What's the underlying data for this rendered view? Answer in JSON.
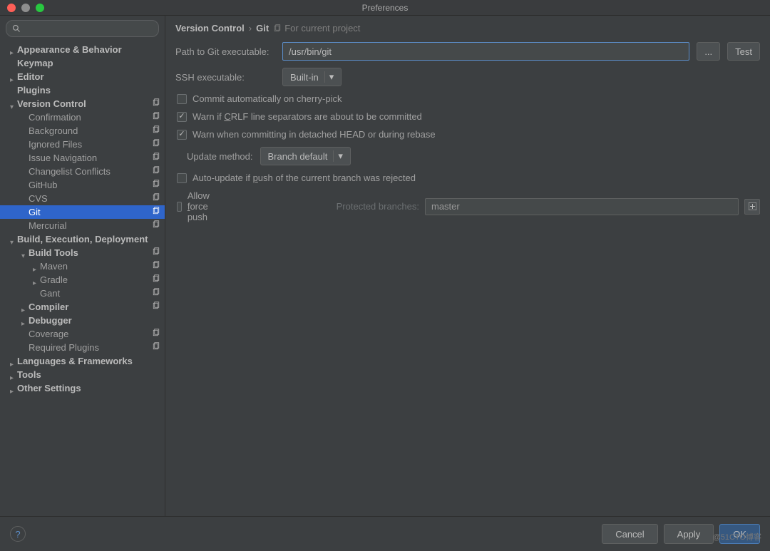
{
  "window": {
    "title": "Preferences"
  },
  "search": {
    "placeholder": ""
  },
  "tree": [
    {
      "label": "Appearance & Behavior",
      "level": 0,
      "arrow": "col",
      "bold": true
    },
    {
      "label": "Keymap",
      "level": 0,
      "arrow": "none",
      "bold": true
    },
    {
      "label": "Editor",
      "level": 0,
      "arrow": "col",
      "bold": true
    },
    {
      "label": "Plugins",
      "level": 0,
      "arrow": "none",
      "bold": true
    },
    {
      "label": "Version Control",
      "level": 0,
      "arrow": "exp",
      "bold": true,
      "badge": true
    },
    {
      "label": "Confirmation",
      "level": 1,
      "arrow": "none",
      "badge": true
    },
    {
      "label": "Background",
      "level": 1,
      "arrow": "none",
      "badge": true
    },
    {
      "label": "Ignored Files",
      "level": 1,
      "arrow": "none",
      "badge": true
    },
    {
      "label": "Issue Navigation",
      "level": 1,
      "arrow": "none",
      "badge": true
    },
    {
      "label": "Changelist Conflicts",
      "level": 1,
      "arrow": "none",
      "badge": true
    },
    {
      "label": "GitHub",
      "level": 1,
      "arrow": "none",
      "badge": true
    },
    {
      "label": "CVS",
      "level": 1,
      "arrow": "none",
      "badge": true
    },
    {
      "label": "Git",
      "level": 1,
      "arrow": "none",
      "badge": true,
      "selected": true
    },
    {
      "label": "Mercurial",
      "level": 1,
      "arrow": "none",
      "badge": true
    },
    {
      "label": "Build, Execution, Deployment",
      "level": 0,
      "arrow": "exp",
      "bold": true
    },
    {
      "label": "Build Tools",
      "level": 1,
      "arrow": "exp",
      "bold": true,
      "badge": true
    },
    {
      "label": "Maven",
      "level": 2,
      "arrow": "col",
      "badge": true
    },
    {
      "label": "Gradle",
      "level": 2,
      "arrow": "col",
      "badge": true
    },
    {
      "label": "Gant",
      "level": 2,
      "arrow": "none",
      "badge": true
    },
    {
      "label": "Compiler",
      "level": 1,
      "arrow": "col",
      "bold": true,
      "badge": true
    },
    {
      "label": "Debugger",
      "level": 1,
      "arrow": "col",
      "bold": true
    },
    {
      "label": "Coverage",
      "level": 1,
      "arrow": "none",
      "badge": true
    },
    {
      "label": "Required Plugins",
      "level": 1,
      "arrow": "none",
      "badge": true
    },
    {
      "label": "Languages & Frameworks",
      "level": 0,
      "arrow": "col",
      "bold": true
    },
    {
      "label": "Tools",
      "level": 0,
      "arrow": "col",
      "bold": true
    },
    {
      "label": "Other Settings",
      "level": 0,
      "arrow": "col",
      "bold": true
    }
  ],
  "breadcrumb": {
    "root": "Version Control",
    "current": "Git",
    "scope": "For current project"
  },
  "form": {
    "path_label": "Path to Git executable:",
    "path_value": "/usr/bin/git",
    "browse_label": "...",
    "test_label": "Test",
    "ssh_label": "SSH executable:",
    "ssh_value": "Built-in",
    "cb_commit_auto": "Commit automatically on cherry-pick",
    "cb_warn_crlf_pre": "Warn if ",
    "cb_warn_crlf_u": "C",
    "cb_warn_crlf_post": "RLF line separators are about to be committed",
    "cb_warn_detached": "Warn when committing in detached HEAD or during rebase",
    "update_label": "Update method:",
    "update_value": "Branch default",
    "cb_auto_update_pre": "Auto-update if ",
    "cb_auto_update_u": "p",
    "cb_auto_update_post": "ush of the current branch was rejected",
    "cb_allow_force_pre": "Allow ",
    "cb_allow_force_u": "f",
    "cb_allow_force_post": "orce push",
    "protected_label": "Protected branches:",
    "protected_value": "master"
  },
  "footer": {
    "cancel": "Cancel",
    "apply": "Apply",
    "ok": "OK"
  },
  "watermark": "@51CTO博客"
}
